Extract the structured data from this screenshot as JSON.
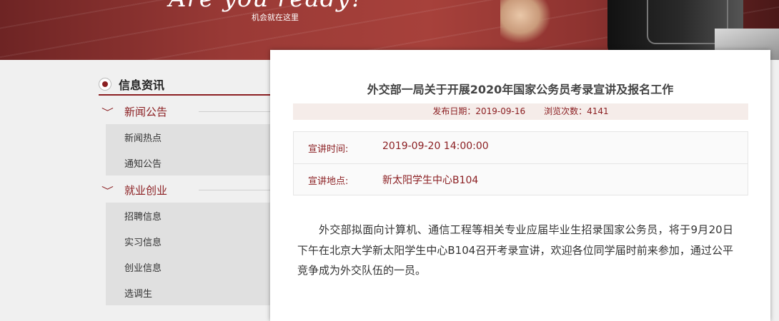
{
  "banner": {
    "slogan": "Are you ready?",
    "subtitle": "机会就在这里"
  },
  "sidebar": {
    "heading": "信息资讯",
    "categories": [
      {
        "label": "新闻公告",
        "items": [
          "新闻热点",
          "通知公告"
        ]
      },
      {
        "label": "就业创业",
        "items": [
          "招聘信息",
          "实习信息",
          "创业信息",
          "选调生"
        ]
      }
    ]
  },
  "article": {
    "title": "外交部一局关于开展2020年国家公务员考录宣讲及报名工作",
    "publish_date_text": "发布日期：2019-09-16",
    "views_text": "浏览次数：4141",
    "details": [
      {
        "key": "宣讲时间:",
        "value": "2019-09-20 14:00:00"
      },
      {
        "key": "宣讲地点:",
        "value": "新太阳学生中心B104"
      }
    ],
    "body": "外交部拟面向计算机、通信工程等相关专业应届毕业生招录国家公务员，将于9月20日下午在北京大学新太阳学生中心B104召开考录宣讲，欢迎各位同学届时前来参加，通过公平竞争成为外交队伍的一员。"
  },
  "colors": {
    "accent": "#8b1f22",
    "banner": "#a7413b",
    "meta_bg": "#f5ece9"
  }
}
